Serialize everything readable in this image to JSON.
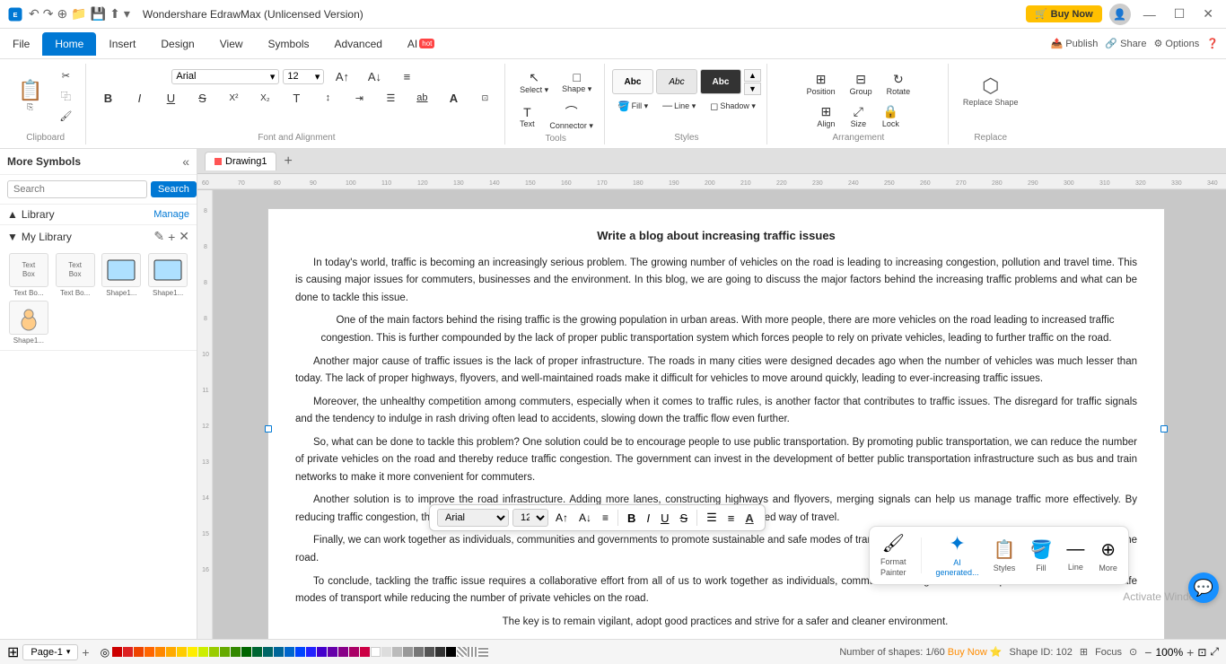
{
  "app": {
    "title": "Wondershare EdrawMax (Unlicensed Version)",
    "buy_now": "Buy Now",
    "window_controls": [
      "—",
      "☐",
      "✕"
    ]
  },
  "menu": {
    "items": [
      "File",
      "Home",
      "Insert",
      "Design",
      "View",
      "Symbols",
      "Advanced",
      "AI"
    ],
    "active": "Home"
  },
  "toolbar": {
    "clipboard": {
      "label": "Clipboard",
      "paste": "⎘",
      "cut": "✂",
      "copy": "⿻",
      "format_painter": "🖌"
    },
    "font_family": "Arial",
    "font_size": "12",
    "alignment_label": "Font and Alignment",
    "tools": {
      "label": "Tools",
      "select": "Select ▾",
      "shape": "Shape ▾",
      "text": "Text",
      "connector": "Connector ▾"
    },
    "styles": {
      "label": "Styles",
      "options": [
        "Abc",
        "Abc",
        "Abc"
      ]
    },
    "arrangement": {
      "label": "Arrangement",
      "position": "Position",
      "group": "Group",
      "rotate": "Rotate",
      "align": "Align",
      "size": "Size",
      "lock": "Lock"
    },
    "replace": {
      "label": "Replace",
      "replace_shape": "Replace\nShape"
    },
    "fill": "Fill ▾",
    "line": "Line ▾",
    "shadow": "Shadow ▾"
  },
  "sidebar": {
    "title": "More Symbols",
    "search_placeholder": "Search",
    "search_btn": "Search",
    "library_label": "Library",
    "manage_btn": "Manage",
    "my_library": "My Library",
    "thumbnails": [
      {
        "label": "Text Bo...",
        "type": "text"
      },
      {
        "label": "Text Bo...",
        "type": "text"
      },
      {
        "label": "Shape1...",
        "type": "shape"
      },
      {
        "label": "Shape1...",
        "type": "shape"
      },
      {
        "label": "Shape1...",
        "type": "figure"
      }
    ]
  },
  "tabs": {
    "active_tab": "Drawing1",
    "add_tab": "+"
  },
  "document": {
    "title": "Write a blog about increasing traffic issues",
    "content": [
      "In today's world, traffic is becoming an increasingly serious problem. The growing number of vehicles on the road is leading to increasing congestion, pollution and travel time. This is causing major issues for commuters, businesses and the environment. In this blog, we are going to discuss the major factors behind the increasing traffic problems and what can be done to tackle this issue.",
      "One of the main factors behind the rising traffic is the growing population in urban areas. With more people, there are more vehicles on the road leading to increased traffic congestion. This is further compounded by the lack of proper public transportation system which forces people to rely on private vehicles, leading to further traffic on the road.",
      "Another major cause of traffic issues is the lack of proper infrastructure. The roads in many cities were designed decades ago when the number of vehicles was much lesser than today. The lack of proper highways, flyovers, and well-maintained roads make it difficult for vehicles to move around quickly, leading to ever-increasing traffic issues.",
      "Moreover, the unhealthy competition among commuters, especially when it comes to traffic rules, is another factor that contributes to traffic issues. The disregard for traffic signals and the tendency to indulge in rash driving often lead to accidents, slowing down the traffic flow even further.",
      "So, what can be done to tackle this problem? One solution could be to encourage people to use public transportation. By promoting public transportation, we can reduce the number of private vehicles on the road and thereby reduce traffic congestion. The government can invest in the development of better public transportation infrastructure such as bus and train networks to make it more convenient for commuters.",
      "Another solution is to improve the road infrastructure. Adding more lanes, constructing highways and flyovers, merging signals can help us manage traffic more effectively. By reducing traffic congestion, the stress on the drivers will also be reduced, promoting a safe and organized way of travel.",
      "Finally, we can work together as individuals, communities and governments to promote sustainable and safe modes of transport while reducing the number of private vehicles on the road.",
      "To conclude, tackling the traffic issue requires a collaborative effort from all of us to work together as individuals, communities and governments to promote sustainable and safe modes of transport while reducing the number of private vehicles on the road.",
      "The key is to remain vigilant, adopt good practices and strive for a safer and cleaner environment."
    ]
  },
  "floating_toolbar": {
    "font": "Arial",
    "size": "12",
    "bold": "B",
    "italic": "I",
    "underline": "U",
    "strike": "S",
    "list": "☰",
    "bullets": "≡",
    "color_label": "A"
  },
  "floating_action_bar": {
    "format_painter": "Format\nPainter",
    "ai_generated": "AI\ngenerated...",
    "styles": "Styles",
    "fill": "Fill",
    "line": "Line",
    "more": "More"
  },
  "status_bar": {
    "page_label": "Page-1",
    "page_indicator": "Page-1",
    "shape_count": "Number of shapes: 1/60",
    "buy_now": "Buy Now",
    "shape_id": "Shape ID: 102",
    "focus": "Focus",
    "zoom": "100%"
  },
  "colors": {
    "accent_blue": "#0078d4",
    "buy_now_yellow": "#ffc000",
    "ai_blue": "#0078d4"
  }
}
